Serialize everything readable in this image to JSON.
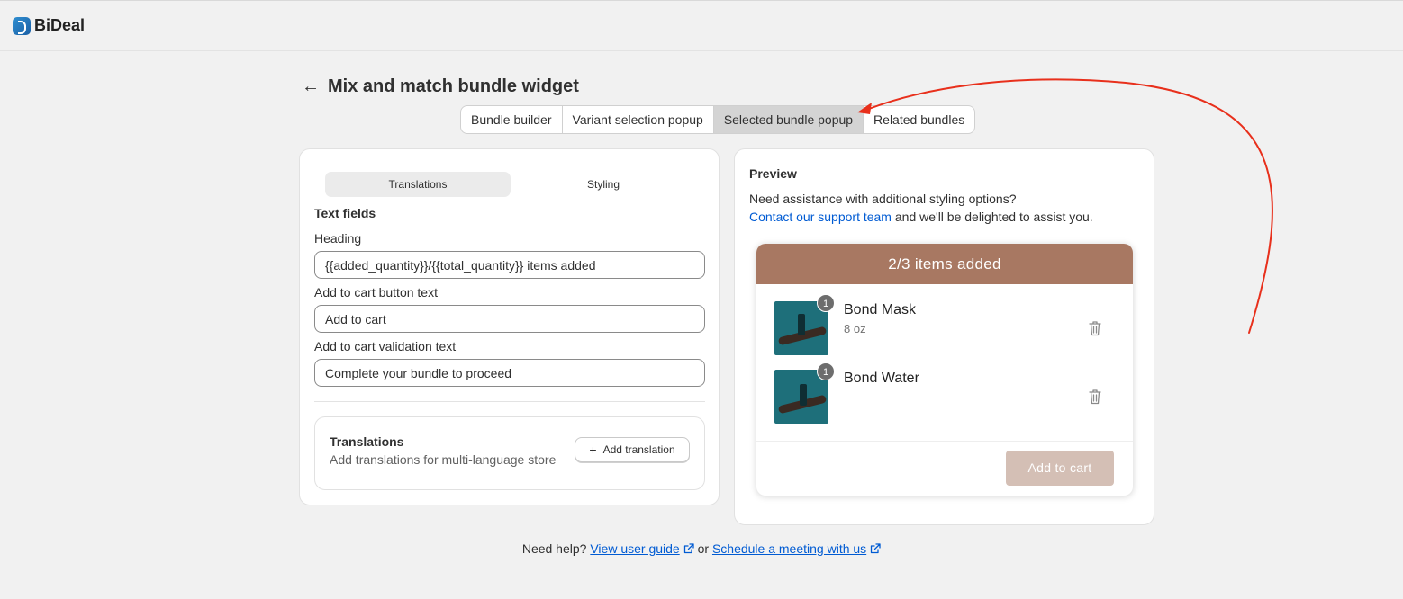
{
  "app": {
    "name": "BiDeal"
  },
  "header": {
    "title": "Mix and match bundle widget"
  },
  "tabs": [
    {
      "label": "Bundle builder"
    },
    {
      "label": "Variant selection popup"
    },
    {
      "label": "Selected bundle popup"
    },
    {
      "label": "Related bundles"
    }
  ],
  "active_tab": "Selected bundle popup",
  "settings": {
    "segments": [
      {
        "label": "Translations"
      },
      {
        "label": "Styling"
      }
    ],
    "section_title": "Text fields",
    "fields": [
      {
        "label": "Heading",
        "value": "{{added_quantity}}/{{total_quantity}} items added"
      },
      {
        "label": "Add to cart button text",
        "value": "Add to cart"
      },
      {
        "label": "Add to cart validation text",
        "value": "Complete your bundle to proceed"
      }
    ],
    "translations": {
      "title": "Translations",
      "subtitle": "Add translations for multi-language store",
      "button_label": "Add translation"
    }
  },
  "preview": {
    "title": "Preview",
    "line1": "Need assistance with additional styling options?",
    "link_text": "Contact our support team",
    "line2_rest": " and we'll be delighted to assist you.",
    "popup": {
      "heading": "2/3 items added",
      "items": [
        {
          "name": "Bond Mask",
          "variant": "8 oz",
          "quantity": "1"
        },
        {
          "name": "Bond Water",
          "variant": "",
          "quantity": "1"
        }
      ],
      "cart_button": "Add to cart"
    },
    "colors": {
      "popup_header": "#a87862",
      "cart_button_disabled": "#d4bfb5"
    }
  },
  "help": {
    "prefix": "Need help?",
    "guide_link": "View user guide",
    "or": " or ",
    "meeting_link": "Schedule a meeting with us"
  },
  "colors": {
    "accent_link": "#005bd3",
    "annotation_arrow": "#e8301c"
  }
}
